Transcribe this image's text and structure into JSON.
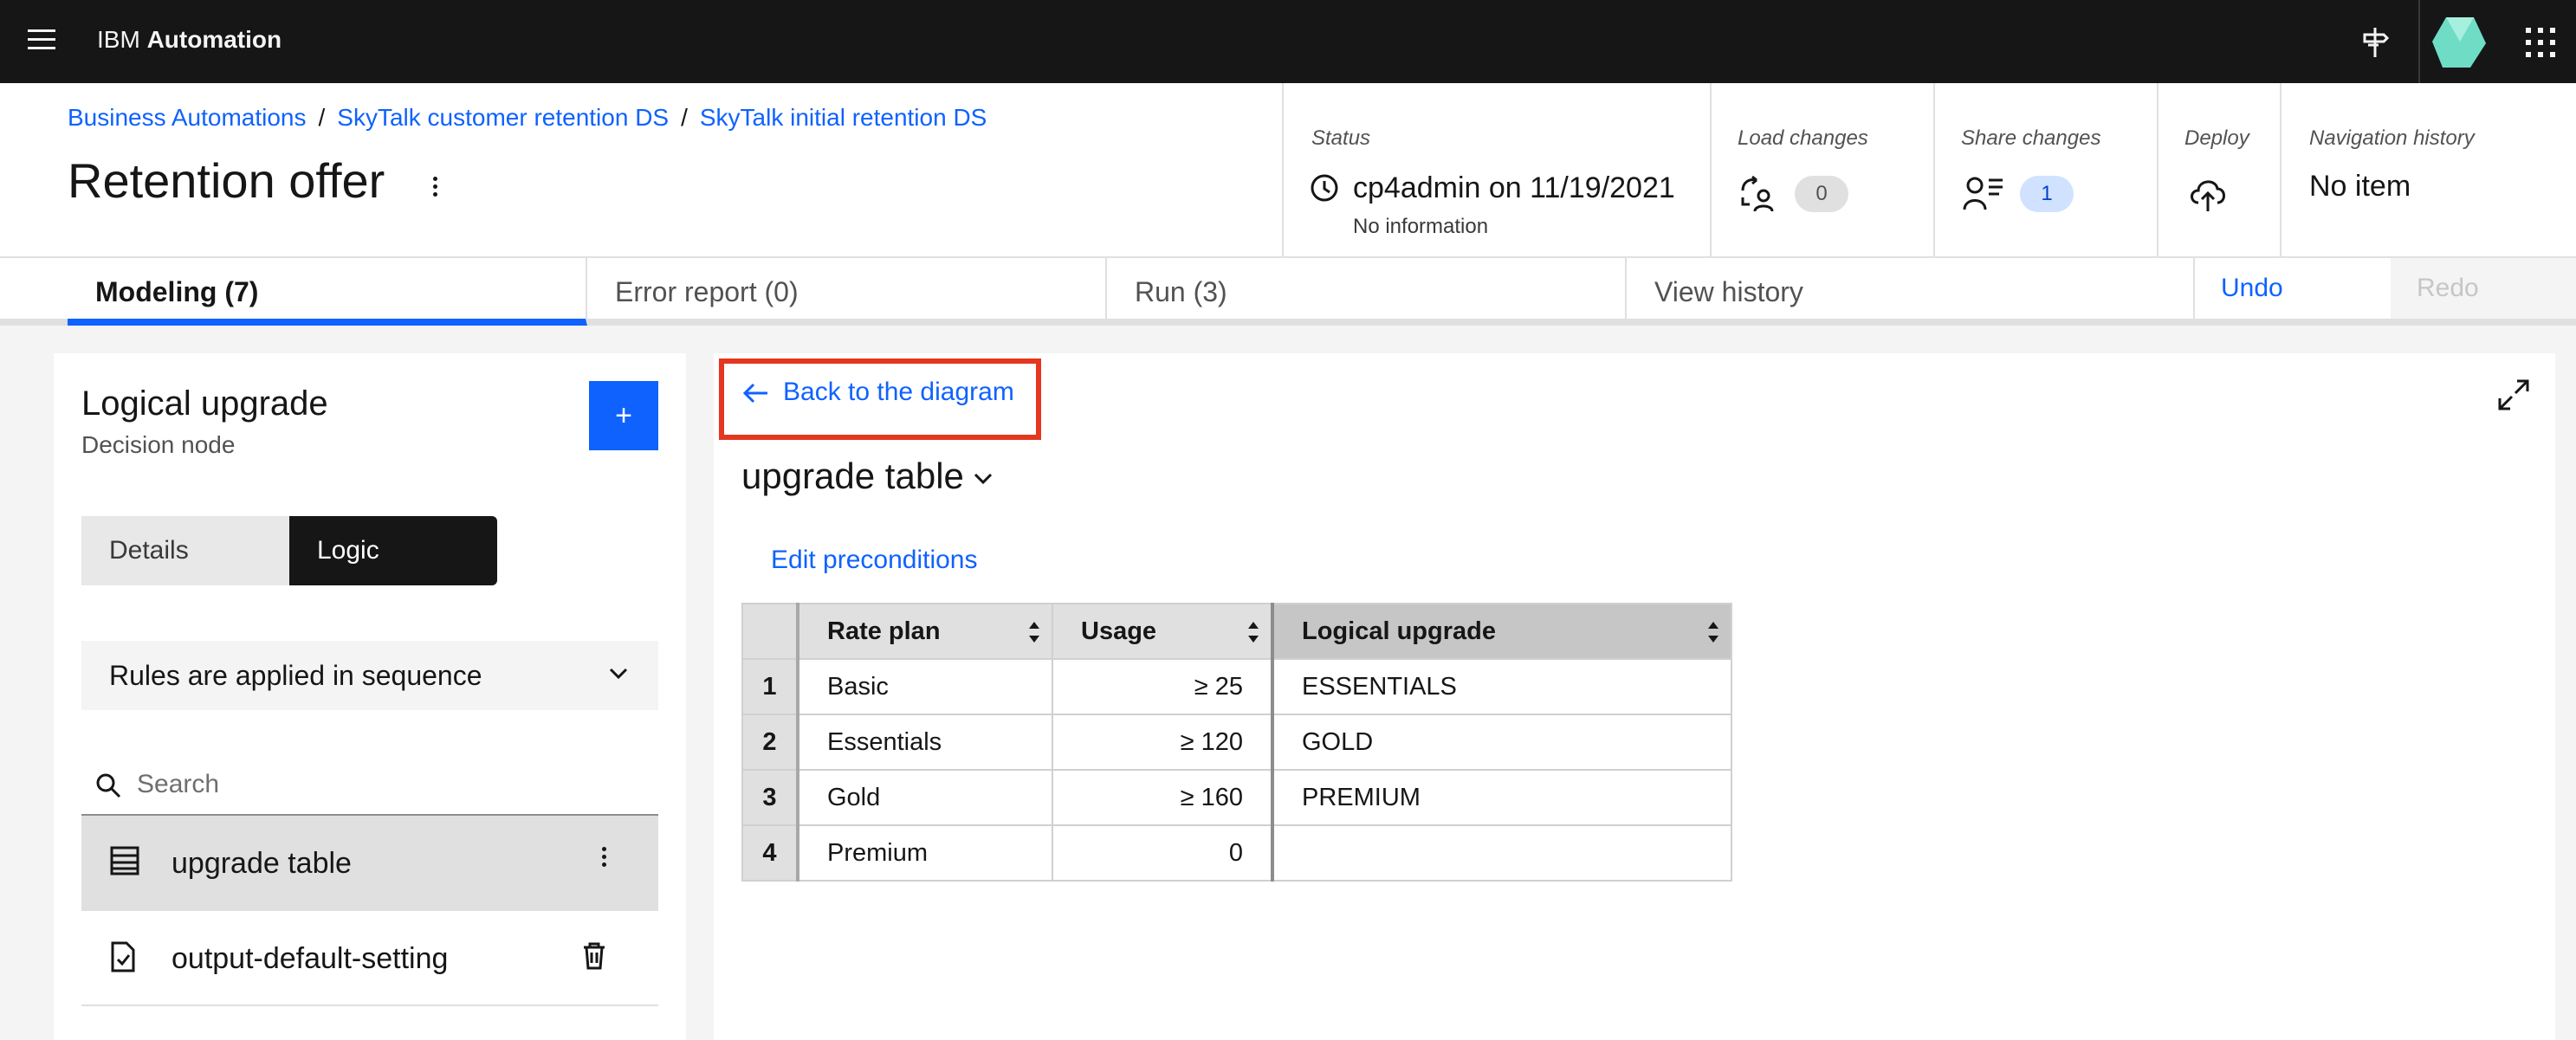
{
  "topbar": {
    "brand_prefix": "IBM",
    "brand_name": "Automation"
  },
  "breadcrumb": [
    "Business Automations",
    "SkyTalk customer retention DS",
    "SkyTalk initial retention DS"
  ],
  "page_title": "Retention offer",
  "status": {
    "label": "Status",
    "value": "cp4admin on 11/19/2021",
    "info": "No information"
  },
  "load_changes": {
    "label": "Load changes",
    "count": "0"
  },
  "share_changes": {
    "label": "Share changes",
    "count": "1"
  },
  "deploy": {
    "label": "Deploy"
  },
  "navigation_history": {
    "label": "Navigation history",
    "value": "No item"
  },
  "tabs": [
    {
      "label": "Modeling (7)",
      "active": true
    },
    {
      "label": "Error report (0)",
      "active": false
    },
    {
      "label": "Run (3)",
      "active": false
    },
    {
      "label": "View history",
      "active": false
    }
  ],
  "actions": {
    "undo": "Undo",
    "redo": "Redo"
  },
  "left_panel": {
    "node_name": "Logical upgrade",
    "node_type": "Decision node",
    "add_label": "+",
    "segments": {
      "details": "Details",
      "logic": "Logic"
    },
    "rules_mode": "Rules are applied in sequence",
    "search_placeholder": "Search",
    "items": [
      {
        "label": "upgrade table",
        "icon": "table-icon",
        "selected": true
      },
      {
        "label": "output-default-setting",
        "icon": "document-check-icon",
        "selected": false
      }
    ]
  },
  "main_panel": {
    "back_label": "Back to the diagram",
    "table_name": "upgrade table",
    "edit_preconditions": "Edit preconditions",
    "columns": [
      "Rate plan",
      "Usage",
      "Logical upgrade"
    ],
    "rows": [
      {
        "index": "1",
        "rate_plan": "Basic",
        "usage": "≥ 25",
        "upgrade": "ESSENTIALS"
      },
      {
        "index": "2",
        "rate_plan": "Essentials",
        "usage": "≥ 120",
        "upgrade": "GOLD"
      },
      {
        "index": "3",
        "rate_plan": "Gold",
        "usage": "≥ 160",
        "upgrade": "PREMIUM"
      },
      {
        "index": "4",
        "rate_plan": "Premium",
        "usage": "0",
        "upgrade": ""
      }
    ]
  },
  "colors": {
    "accent": "#0f62fe",
    "topbar": "#161616",
    "highlight_box": "#e5371f"
  }
}
